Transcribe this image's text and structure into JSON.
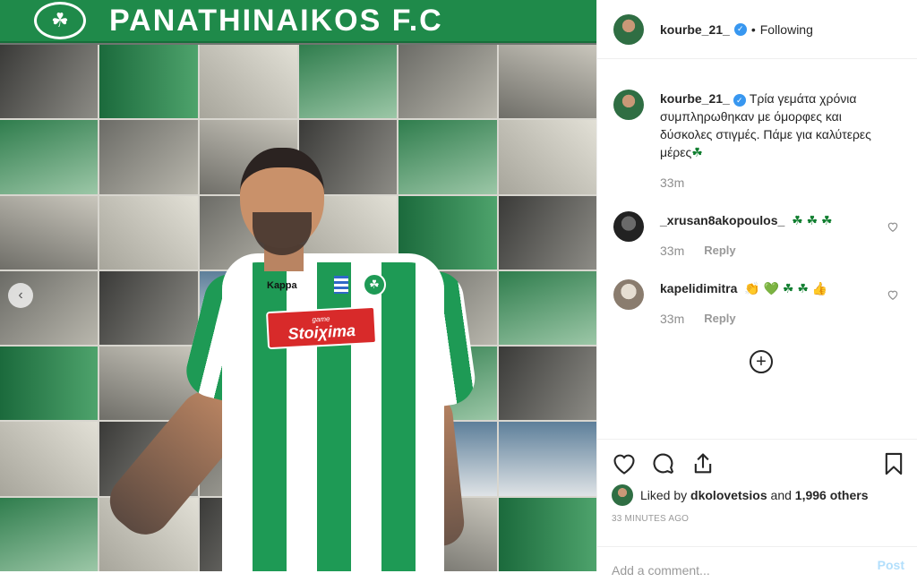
{
  "photo": {
    "banner_text": "PANATHINAIKOS F.C",
    "crest_glyph": "☘",
    "sponsor_small": "game",
    "sponsor_main": "Stoiχima",
    "kit_brand": "Kappa",
    "carousel_glyph": "‹"
  },
  "header": {
    "username": "kourbe_21_",
    "verified_glyph": "✓",
    "separator": "•",
    "follow_status": "Following"
  },
  "caption": {
    "username": "kourbe_21_",
    "text": "Τρία γεμάτα χρόνια συμπληρωθηκαν με όμορφες και δύσκολες στιγμές. Πάμε για καλύτερες μέρες",
    "emoji": "☘",
    "time": "33m"
  },
  "comments": [
    {
      "username": "_xrusan8akopoulos_",
      "text": "☘ ☘ ☘",
      "time": "33m",
      "reply_label": "Reply"
    },
    {
      "username": "kapelidimitra",
      "text": "👏 💚 ☘ ☘ 👍",
      "time": "33m",
      "reply_label": "Reply"
    }
  ],
  "load_more_glyph": "+",
  "actions": [
    "heart-icon",
    "comment-icon",
    "share-icon",
    "bookmark-icon"
  ],
  "likes": {
    "prefix": "Liked by",
    "user": "dkolovetsios",
    "middle": "and",
    "count": "1,996 others"
  },
  "timestamp": "33 MINUTES AGO",
  "add_comment": {
    "placeholder": "Add a comment...",
    "post_label": "Post"
  },
  "colors": {
    "club_green": "#1f8a4a",
    "verified_blue": "#3897f0",
    "post_button": "#b2dffc"
  }
}
